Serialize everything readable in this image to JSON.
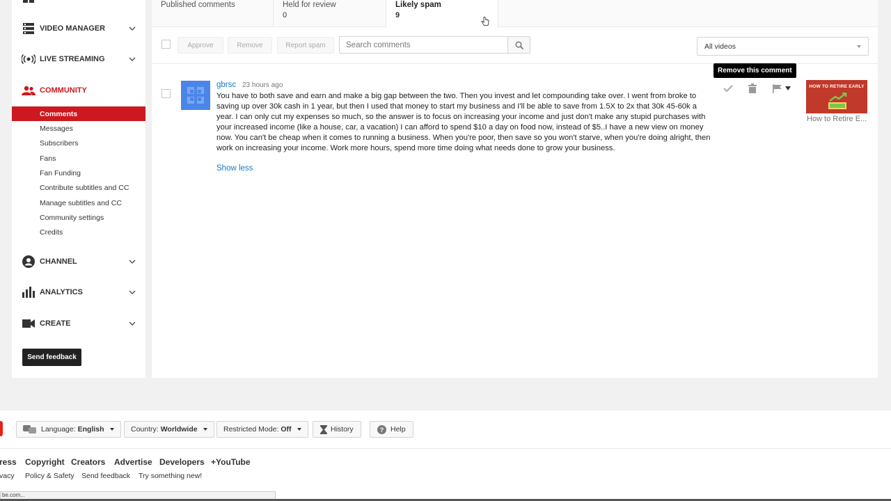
{
  "sidebar": {
    "sections": {
      "video_manager": "VIDEO MANAGER",
      "live_streaming": "LIVE STREAMING",
      "community": "COMMUNITY",
      "channel": "CHANNEL",
      "analytics": "ANALYTICS",
      "create": "CREATE"
    },
    "community_items": [
      "Comments",
      "Messages",
      "Subscribers",
      "Fans",
      "Fan Funding",
      "Contribute subtitles and CC",
      "Manage subtitles and CC",
      "Community settings",
      "Credits"
    ],
    "send_feedback": "Send feedback",
    "accent_color": "#cc181e"
  },
  "tabs": [
    {
      "label": "Published comments",
      "count": ""
    },
    {
      "label": "Held for review",
      "count": "0"
    },
    {
      "label": "Likely spam",
      "count": "9"
    }
  ],
  "toolbar": {
    "approve": "Approve",
    "remove": "Remove",
    "report_spam": "Report spam",
    "search_placeholder": "Search comments",
    "video_filter": "All videos"
  },
  "comment": {
    "author": "gbrsc",
    "time": "23 hours ago",
    "text": "You have to both save and earn and make a big gap between the two. Then you invest and let compounding take over. I went from broke to saving up over 30k cash in 1 year, but then I used that money to start my business and I'll be able to save from 1.5X to 2x that 30k 45-60k a year. I can only cut my expenses so much, so the answer is to focus on increasing your income and just don't make any stupid purchases with your increased income (like a house, car, a vacation) I can afford to spend $10 a day on food now, instead of $5..I have a new view on money now. You can't be cheap when it comes to running a business. When you're poor, then save so you won't starve, when you're doing alright, then work on increasing your income. Work more hours, spend more time doing what needs done to grow your business.",
    "show_less": "Show less",
    "tooltip": "Remove this comment",
    "video_thumb_text": "HOW TO RETIRE EARLY",
    "video_title": "How to Retire E..."
  },
  "footer": {
    "language_label": "Language:",
    "language_value": "English",
    "country_label": "Country:",
    "country_value": "Worldwide",
    "restricted_label": "Restricted Mode:",
    "restricted_value": "Off",
    "history": "History",
    "help": "Help",
    "links_row1": [
      "ress",
      "Copyright",
      "Creators",
      "Advertise",
      "Developers",
      "+YouTube"
    ],
    "links_row2": [
      "vacy",
      "Policy & Safety",
      "Send feedback",
      "Try something new!"
    ],
    "status_text": "be.com..."
  }
}
